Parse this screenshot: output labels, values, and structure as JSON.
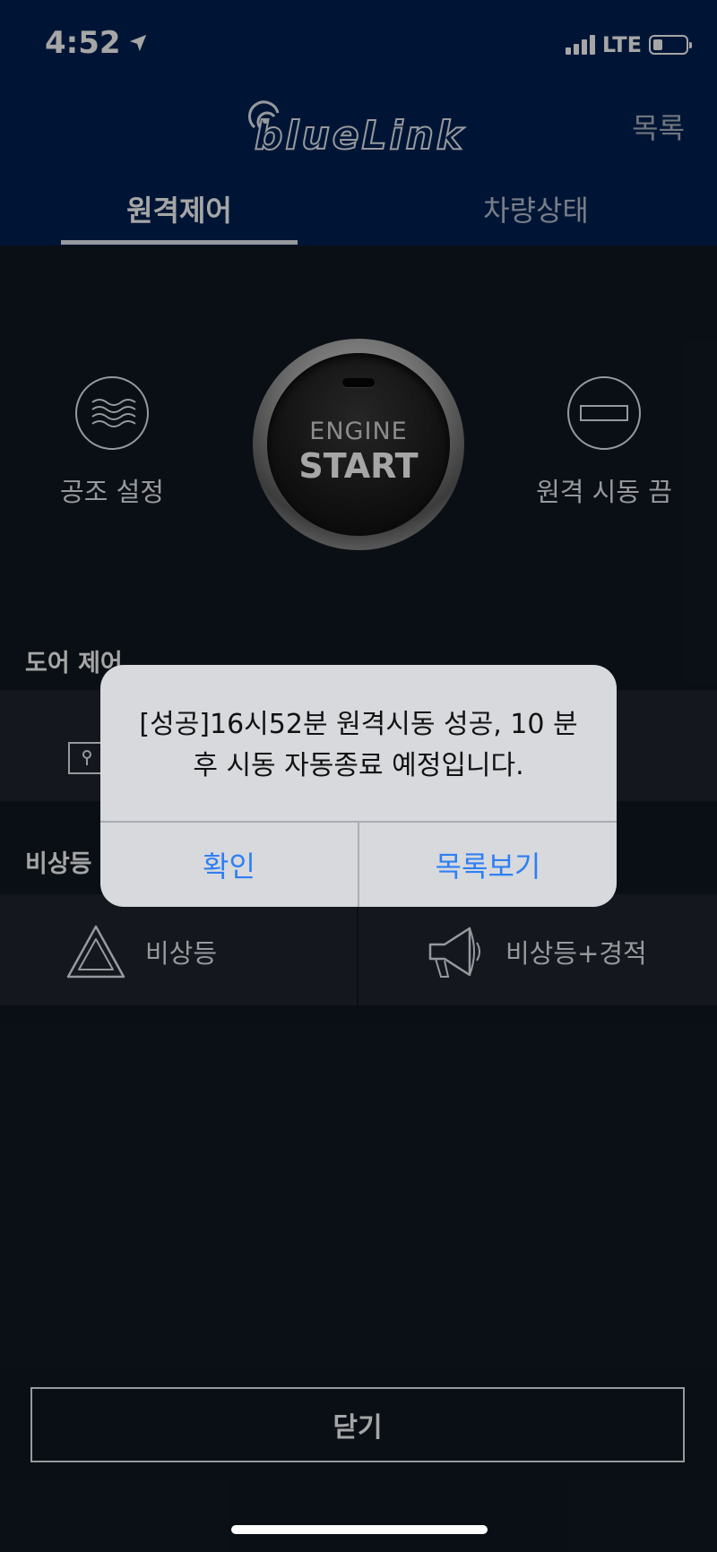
{
  "status_bar": {
    "time": "4:52",
    "network": "LTE"
  },
  "header": {
    "logo_text": "blueLink",
    "list_label": "목록",
    "tabs": [
      {
        "label": "원격제어",
        "active": true
      },
      {
        "label": "차량상태",
        "active": false
      }
    ]
  },
  "controls": {
    "climate_label": "공조 설정",
    "engine": {
      "line1": "ENGINE",
      "line2": "START"
    },
    "remote_off_label": "원격 시동 끔"
  },
  "sections": {
    "door_title": "도어 제어",
    "hazard_title": "비상등",
    "hazard_items": [
      {
        "label": "비상등",
        "icon": "triangle-warning-icon"
      },
      {
        "label": "비상등+경적",
        "icon": "megaphone-icon"
      }
    ]
  },
  "alert": {
    "message": "[성공]16시52분 원격시동 성공, 10 분후 시동 자동종료 예정입니다.",
    "ok_label": "확인",
    "list_label": "목록보기"
  },
  "footer": {
    "close_label": "닫기"
  },
  "colors": {
    "header_bg": "#002152",
    "page_bg": "#101821",
    "row_bg": "#1f262f",
    "alert_bg": "#d7d9dd",
    "ios_blue": "#2f7ff2"
  }
}
